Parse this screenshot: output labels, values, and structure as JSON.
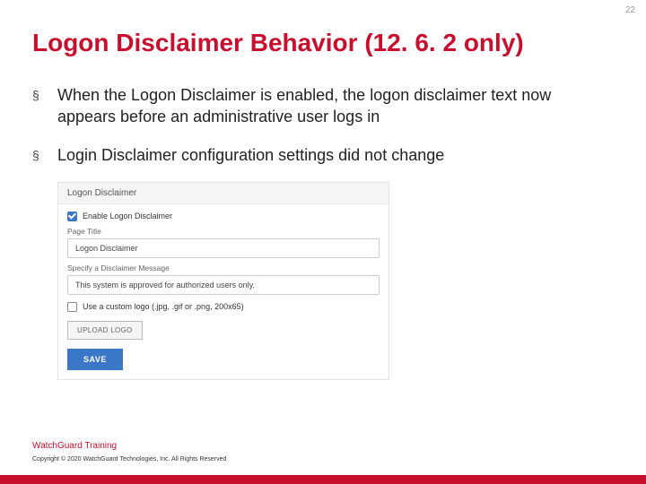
{
  "page_number": "22",
  "title": "Logon Disclaimer Behavior (12. 6. 2 only)",
  "bullets": [
    "When the Logon Disclaimer is enabled, the logon disclaimer text now appears before an administrative user logs in",
    "Login Disclaimer configuration settings did not change"
  ],
  "panel": {
    "header": "Logon Disclaimer",
    "enable_label": "Enable Logon Disclaimer",
    "page_title_label": "Page Title",
    "page_title_value": "Logon Disclaimer",
    "message_label": "Specify a Disclaimer Message",
    "message_value": "This system is approved for authorized users only.",
    "custom_logo_label": "Use a custom logo (.jpg, .gif or .png, 200x65)",
    "upload_label": "UPLOAD LOGO",
    "save_label": "SAVE"
  },
  "footer": {
    "training": "WatchGuard Training",
    "copyright": "Copyright © 2020 WatchGuard Technologies, Inc. All Rights Reserved"
  }
}
